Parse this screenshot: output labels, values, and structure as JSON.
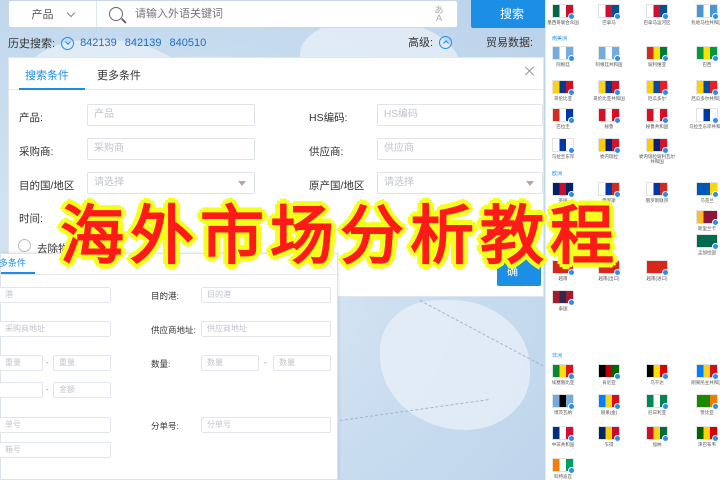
{
  "search": {
    "product_select": "产品",
    "placeholder": "请输入外语关键词",
    "button": "搜索"
  },
  "history": {
    "label": "历史搜索:",
    "items": [
      "842139",
      "842139",
      "840510"
    ],
    "advanced_label": "高级:",
    "trade_label": "贸易数据:"
  },
  "panel": {
    "tabs": [
      "搜索条件",
      "更多条件"
    ],
    "fields": {
      "product_label": "产品:",
      "product_placeholder": "产品",
      "hs_label": "HS编码:",
      "hs_placeholder": "HS编码",
      "buyer_label": "采购商:",
      "buyer_placeholder": "采购商",
      "supplier_label": "供应商:",
      "supplier_placeholder": "供应商",
      "dest_label": "目的国/地区",
      "dest_placeholder": "请选择",
      "origin_label": "原产国/地区",
      "origin_placeholder": "请选择",
      "time_label": "时间:",
      "exclude_label": "去除物"
    }
  },
  "overlay": {
    "tab": "多条件",
    "port_placeholder": "港",
    "dest_port_label": "目的港:",
    "dest_port_placeholder": "目的港",
    "buyer_addr_placeholder": "采购商地址",
    "supplier_addr_label": "供应商地址:",
    "supplier_addr_placeholder": "供应商地址",
    "weight_min": "重量",
    "weight_max": "重量",
    "qty_label": "数量:",
    "qty_min": "数量",
    "qty_max": "数量",
    "amount_max": "金额",
    "bill_placeholder": "单号",
    "sub_bill_label": "分单号:",
    "sub_bill_placeholder": "分单号",
    "container_placeholder": "箱号",
    "dash": "-"
  },
  "blue_button_partial": "确",
  "flags": {
    "regions": [
      "南美洲",
      "欧洲",
      "非洲"
    ],
    "names": [
      "墨西哥联合众国",
      "巴拿马",
      "巴拿马运河区",
      "危地马拉共和国",
      "阿根廷",
      "阿根廷共和国",
      "玻利维亚",
      "巴西",
      "哥伦比亚",
      "哥伦比亚共和国",
      "厄瓜多尔",
      "厄瓜多尔共和国",
      "巴拉圭",
      "秘鲁",
      "秘鲁共和国",
      "乌拉圭东岸共和国",
      "乌拉圭东岸",
      "委内瑞拉",
      "委内瑞拉玻利瓦尔共和国",
      "英国",
      "俄罗斯",
      "俄罗斯联邦",
      "乌克兰",
      "哈萨克斯坦",
      "斯里兰卡",
      "孟加拉国",
      "越南",
      "越南(出口)",
      "越南(进口)",
      "泰国",
      "埃塞俄比亚",
      "肯尼亚",
      "乌干达",
      "刚果民主共和国",
      "博茨瓦纳",
      "刚果(金)",
      "尼日利亚",
      "赞比亚",
      "中非共和国",
      "乍得",
      "加纳",
      "津巴布韦",
      "科特迪瓦"
    ]
  },
  "headline": "海外市场分析教程",
  "colors": {
    "accent": "#1d8ee6",
    "headline_fill": "#ff1a1a",
    "headline_outline": "#f5ff1c"
  }
}
